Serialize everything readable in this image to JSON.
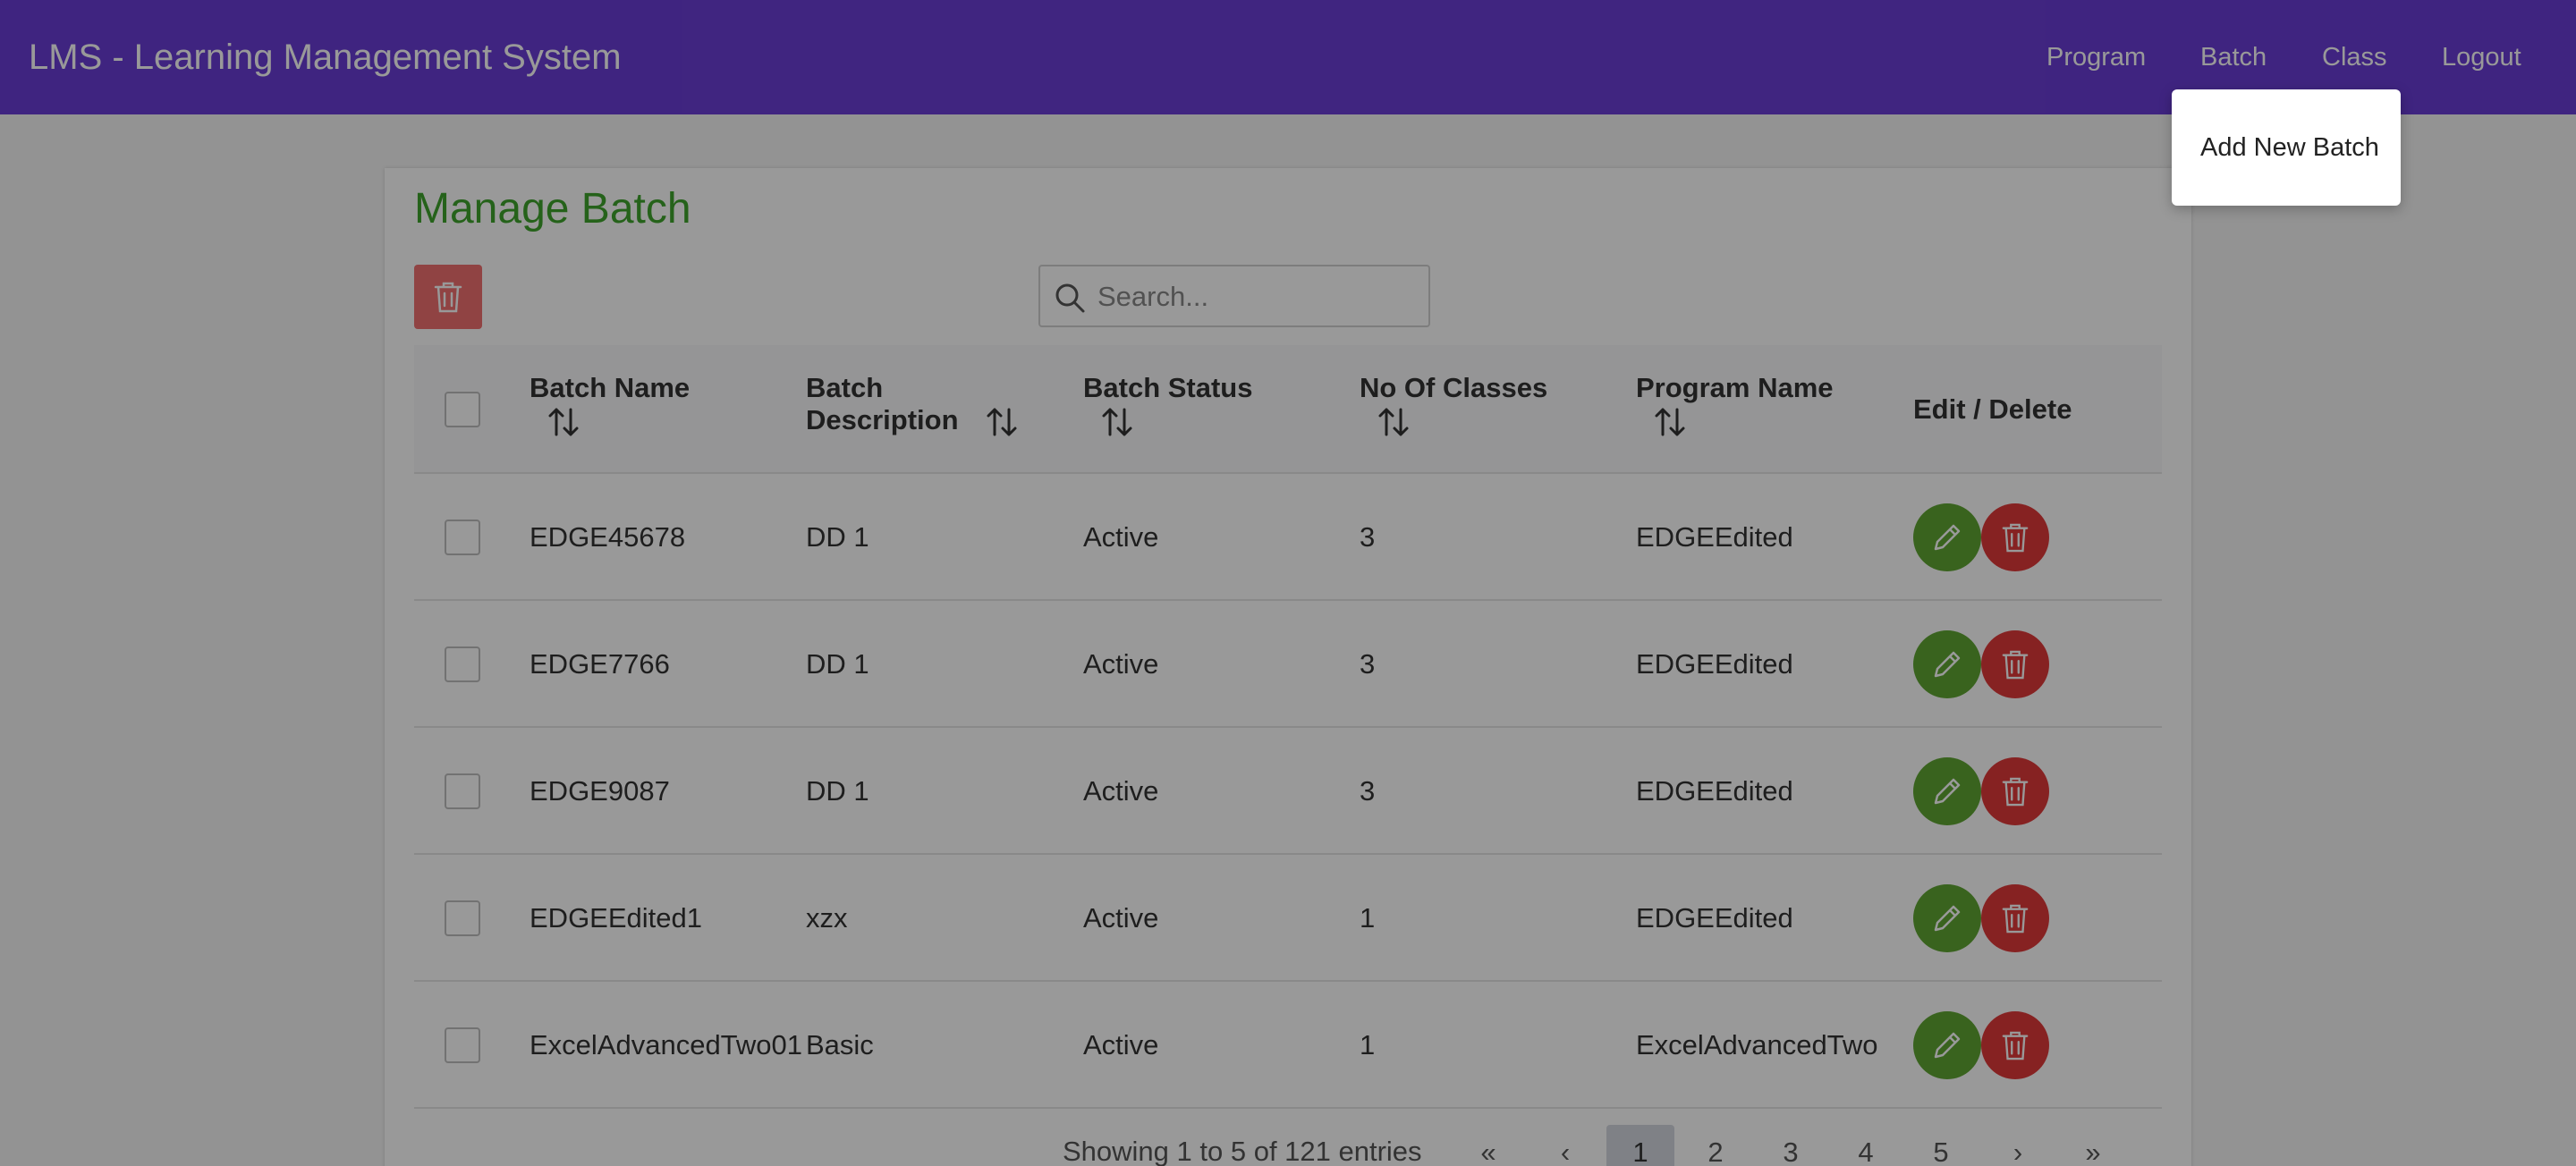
{
  "app": {
    "title": "LMS - Learning Management System"
  },
  "nav": {
    "program": "Program",
    "batch": "Batch",
    "class": "Class",
    "logout": "Logout"
  },
  "dropdown": {
    "add_new_batch": "Add New Batch"
  },
  "page": {
    "title": "Manage Batch"
  },
  "search": {
    "placeholder": "Search..."
  },
  "table": {
    "headers": {
      "batch_name": "Batch Name",
      "batch_description_1": "Batch",
      "batch_description_2": "Description",
      "batch_status": "Batch Status",
      "no_of_classes": "No Of Classes",
      "program_name": "Program Name",
      "edit_delete": "Edit / Delete"
    },
    "rows": [
      {
        "name": "EDGE45678",
        "description": "DD 1",
        "status": "Active",
        "classes": "3",
        "program": "EDGEEdited"
      },
      {
        "name": "EDGE7766",
        "description": "DD 1",
        "status": "Active",
        "classes": "3",
        "program": "EDGEEdited"
      },
      {
        "name": "EDGE9087",
        "description": "DD 1",
        "status": "Active",
        "classes": "3",
        "program": "EDGEEdited"
      },
      {
        "name": "EDGEEdited1",
        "description": "xzx",
        "status": "Active",
        "classes": "1",
        "program": "EDGEEdited"
      },
      {
        "name": "ExcelAdvancedTwo01",
        "description": "Basic",
        "status": "Active",
        "classes": "1",
        "program": "ExcelAdvancedTwo"
      }
    ]
  },
  "pagination": {
    "summary": "Showing 1 to 5 of 121 entries",
    "first": "«",
    "prev": "‹",
    "pages": [
      "1",
      "2",
      "3",
      "4",
      "5"
    ],
    "next": "›",
    "last": "»",
    "active_page": "1"
  },
  "colors": {
    "topbar": "#6a3dd6",
    "title_green": "#3ea32c",
    "edit_green": "#5fa533",
    "delete_red": "#e03a3a",
    "bulk_delete_disabled": "#f07070"
  },
  "icons": {
    "search": "search-icon",
    "sort": "sort-icon",
    "edit": "pencil-icon",
    "delete": "trash-icon"
  }
}
